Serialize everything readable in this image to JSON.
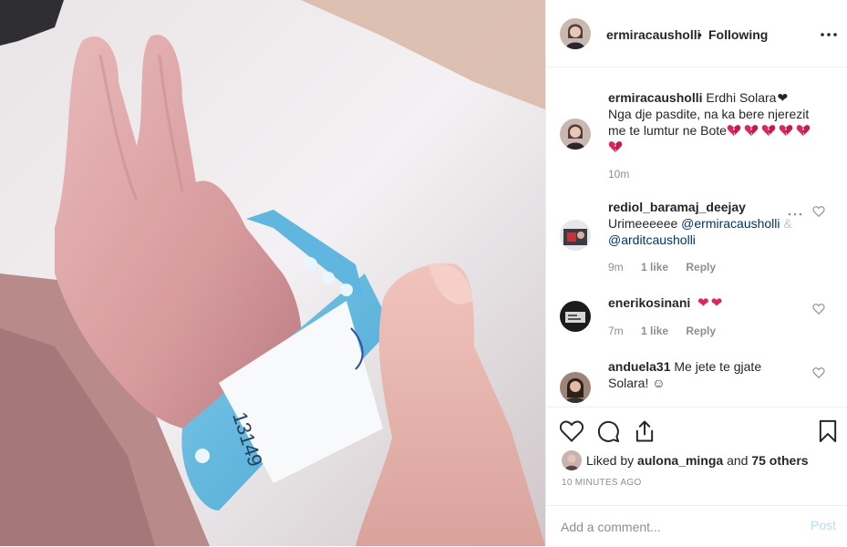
{
  "post": {
    "author": "ermiracausholli",
    "separator": "•",
    "follow_status": "Following",
    "more_icon": "more-dots-icon"
  },
  "caption": {
    "user": "ermiracausholli",
    "line1": "Erdhi Solara",
    "line2": "Nga dje pasdite, na ka bere njerezit",
    "line3": "me te lumtur ne Bote",
    "time": "10m",
    "emoji": "broken-heart-icon"
  },
  "comments": [
    {
      "user": "rediol_baramaj_deejay",
      "text_prefix": "Urimeeeeee ",
      "mention1": "@ermiracausholli",
      "text_mid": " &",
      "mention2": "@arditcausholli",
      "time": "9m",
      "likes": "1 like",
      "reply": "Reply"
    },
    {
      "user": "enerikosinani",
      "time": "7m",
      "likes": "1 like",
      "reply": "Reply"
    },
    {
      "user": "anduela31",
      "text": "Me jete te gjate",
      "text2": "Solara! ☺"
    }
  ],
  "actions": {
    "like_icon": "heart-outline-icon",
    "comment_icon": "comment-bubble-icon",
    "share_icon": "share-icon",
    "save_icon": "bookmark-icon"
  },
  "likes": {
    "prefix": "Liked by ",
    "user": "aulona_minga",
    "mid": " and ",
    "others": "75 others"
  },
  "timestamp": "10 MINUTES AGO",
  "add_comment": {
    "placeholder": "Add a comment...",
    "post_label": "Post"
  },
  "colors": {
    "mention": "#003569",
    "muted": "#8e8e8e",
    "heart": "#ed4956",
    "post_disabled": "#b2dffc"
  }
}
